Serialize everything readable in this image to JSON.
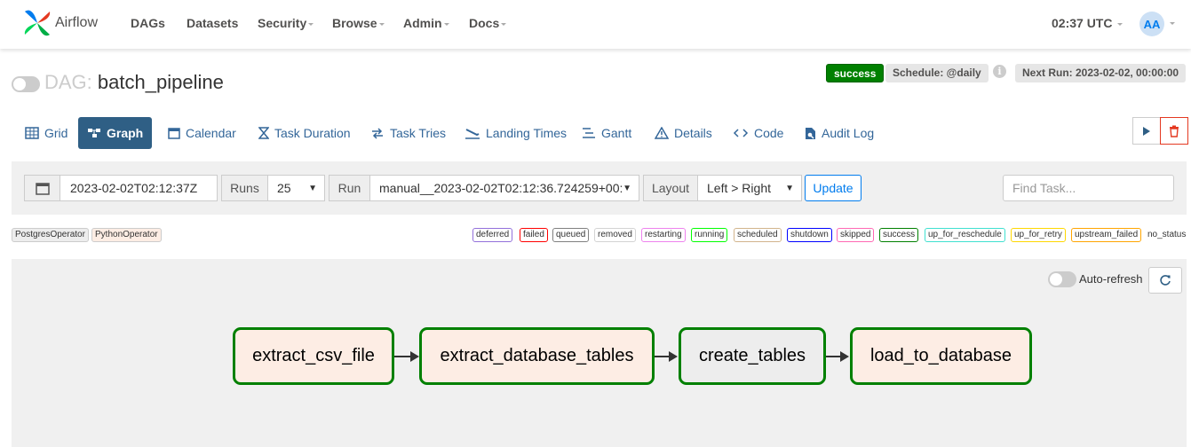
{
  "navbar": {
    "brand": "Airflow",
    "items": [
      {
        "label": "DAGs",
        "dropdown": false
      },
      {
        "label": "Datasets",
        "dropdown": false
      },
      {
        "label": "Security",
        "dropdown": true
      },
      {
        "label": "Browse",
        "dropdown": true
      },
      {
        "label": "Admin",
        "dropdown": true
      },
      {
        "label": "Docs",
        "dropdown": true
      }
    ],
    "time": "02:37 UTC",
    "avatar": "AA"
  },
  "dag": {
    "prefix": "DAG:",
    "name": "batch_pipeline",
    "state": "success",
    "schedule": "Schedule: @daily",
    "next_run": "Next Run: 2023-02-02, 00:00:00"
  },
  "tabs": [
    {
      "label": "Grid",
      "icon": "grid-icon",
      "active": false
    },
    {
      "label": "Graph",
      "icon": "graph-icon",
      "active": true
    },
    {
      "label": "Calendar",
      "icon": "calendar-icon",
      "active": false
    },
    {
      "label": "Task Duration",
      "icon": "hourglass-icon",
      "active": false
    },
    {
      "label": "Task Tries",
      "icon": "retry-icon",
      "active": false
    },
    {
      "label": "Landing Times",
      "icon": "landing-icon",
      "active": false
    },
    {
      "label": "Gantt",
      "icon": "gantt-icon",
      "active": false
    },
    {
      "label": "Details",
      "icon": "warning-icon",
      "active": false
    },
    {
      "label": "Code",
      "icon": "code-icon",
      "active": false
    },
    {
      "label": "Audit Log",
      "icon": "audit-icon",
      "active": false
    }
  ],
  "filters": {
    "base_date": "2023-02-02T02:12:37Z",
    "runs_label": "Runs",
    "runs_value": "25",
    "run_label": "Run",
    "run_value": "manual__2023-02-02T02:12:36.724259+00:00",
    "layout_label": "Layout",
    "layout_value": "Left > Right",
    "update": "Update",
    "find_placeholder": "Find Task..."
  },
  "operators": [
    {
      "label": "PostgresOperator",
      "color": "#ededed"
    },
    {
      "label": "PythonOperator",
      "color": "#fdede4"
    }
  ],
  "states": [
    {
      "label": "deferred",
      "color": "#9370db"
    },
    {
      "label": "failed",
      "color": "#ff0000"
    },
    {
      "label": "queued",
      "color": "#808080"
    },
    {
      "label": "removed",
      "color": "#d3d3d3"
    },
    {
      "label": "restarting",
      "color": "#ee82ee"
    },
    {
      "label": "running",
      "color": "#00ff00"
    },
    {
      "label": "scheduled",
      "color": "#d2b48c"
    },
    {
      "label": "shutdown",
      "color": "#0000ff"
    },
    {
      "label": "skipped",
      "color": "#ff69b4"
    },
    {
      "label": "success",
      "color": "#008000"
    },
    {
      "label": "up_for_reschedule",
      "color": "#40e0d0"
    },
    {
      "label": "up_for_retry",
      "color": "#ffd700"
    },
    {
      "label": "upstream_failed",
      "color": "#ffa500"
    },
    {
      "label": "no_status",
      "color": "#ffffff"
    }
  ],
  "graph": {
    "auto_refresh": "Auto-refresh",
    "nodes": [
      {
        "label": "extract_csv_file",
        "operator": "PythonOperator"
      },
      {
        "label": "extract_database_tables",
        "operator": "PythonOperator"
      },
      {
        "label": "create_tables",
        "operator": "PostgresOperator"
      },
      {
        "label": "load_to_database",
        "operator": "PythonOperator"
      }
    ]
  }
}
